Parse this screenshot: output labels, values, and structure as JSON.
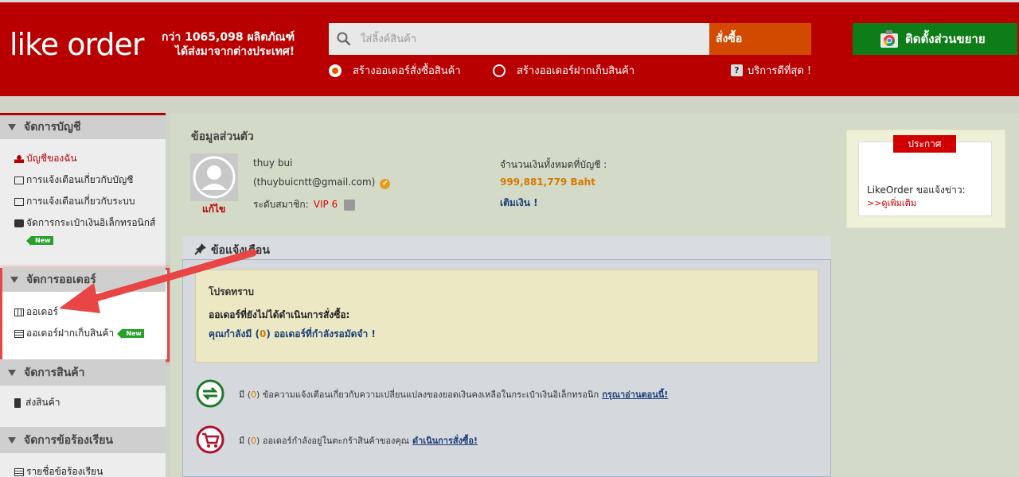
{
  "header": {
    "logo": "like order",
    "tagline_line1": "กว่า 1065,098 ผลิตภัณฑ์",
    "tagline_line2": "ได้ส่งมาจากต่างประเทศ!",
    "search_placeholder": "ใส่ลิ้งค์สินค้า",
    "order_button": "สั่งซื้อ",
    "radio_option_1": "สร้างออเดอร์สั่งซื้อสินค้า",
    "radio_option_2": "สร้างออเดอร์ฝากเก็บสินค้า",
    "help_link": "บริการดีที่สุด !",
    "install_button": "ติดตั้งส่วนขยาย"
  },
  "sidebar": {
    "sections": [
      {
        "title": "จัดการบัญชี",
        "items": [
          "บัญชีของฉัน",
          "การแจ้งเตือนเกี่ยวกับบัญชี",
          "การแจ้งเตือนเกี่ยวกับระบบ",
          "จัดการกระเป๋าเงินอิเล็กทรอนิกส์"
        ]
      },
      {
        "title": "จัดการออเดอร์",
        "items": [
          "ออเดอร์",
          "ออเดอร์ฝากเก็บสินค้า"
        ]
      },
      {
        "title": "จัดการสินค้า",
        "items": [
          "ส่งสินค้า"
        ]
      },
      {
        "title": "จัดการข้อร้องเรียน",
        "items": [
          "รายชื่อข้อร้องเรียน"
        ]
      }
    ],
    "new_badge": "New"
  },
  "profile": {
    "title": "ข้อมูลส่วนตัว",
    "edit": "แก้ไข",
    "name": "thuy bui",
    "email": "(thuybuicntt@gmail.com)",
    "level_label": "ระดับสมาชิก:",
    "level_value": "VIP 6",
    "balance_label": "จำนวนเงินทั้งหมดที่บัญชี :",
    "balance_value": "999,881,779 Baht",
    "topup": "เติมเงิน !"
  },
  "announcement": {
    "tab": "ประกาศ",
    "text": "LikeOrder ขอแจ้งข่าว:",
    "more": ">>ดูเพิ่มเติม"
  },
  "alerts": {
    "title": "ข้อแจ้งเตือน",
    "fyi_title": "โปรดทราบ",
    "fyi_line1": "ออเดอร์ที่ยังไม่ได้ดำเนินการสั่งซื้อ:",
    "fyi_line2_pre": "คุณกำลังมี (",
    "fyi_line2_num": "0",
    "fyi_line2_post": ") ออเดอร์ที่กำลังรอมัดจำ !",
    "row1_pre": "มี (",
    "row1_num": "0",
    "row1_post": ") ข้อความแจ้งเตือนเกี่ยวกับความเปลี่ยนแปลงของยอดเงินคงเหลือในกระเป๋าเงินอิเล็กทรอนิก",
    "row1_link": "กรุณาอ่านตอนนี้!",
    "row2_pre": "มี (",
    "row2_num": "0",
    "row2_post": ") ออเดอร์กำลังอยู่ในตะกร้าสินค้าของคุณ",
    "row2_link": "ดำเนินการสั่งซื้อ!"
  }
}
